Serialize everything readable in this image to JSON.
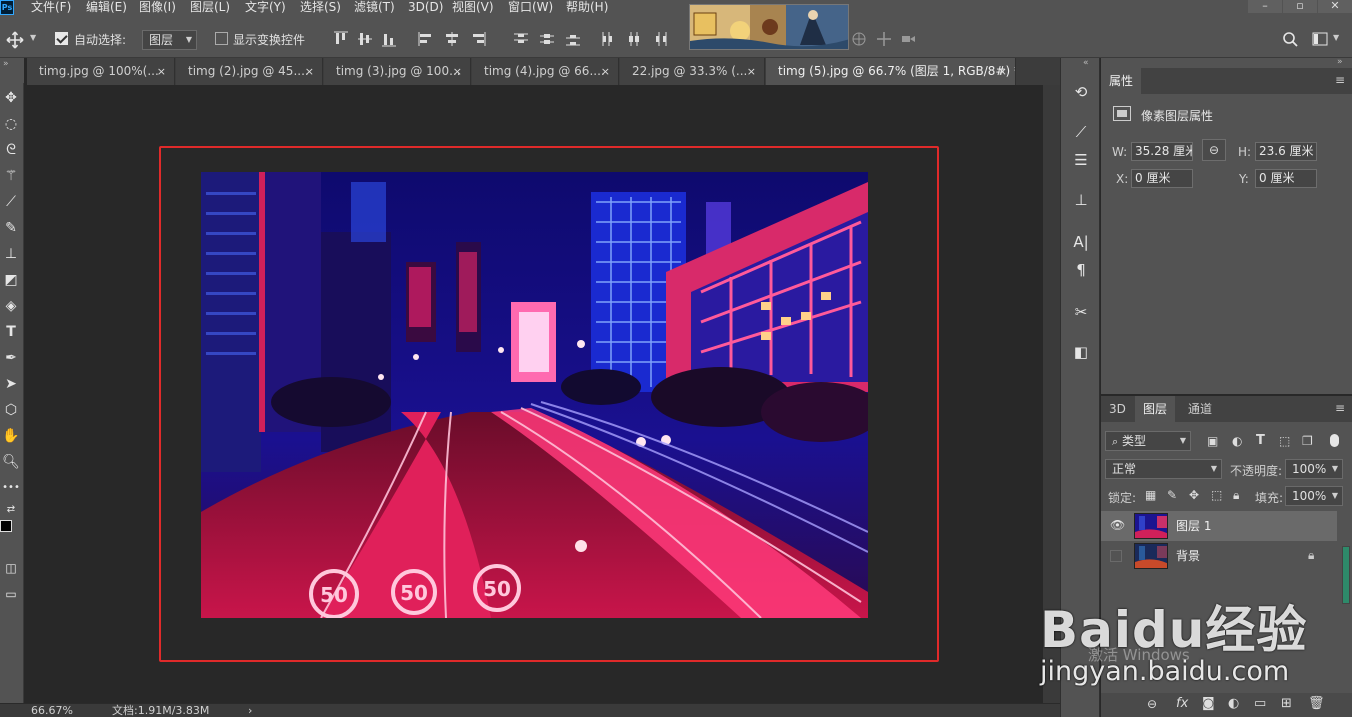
{
  "menu": {
    "items": [
      "文件(F)",
      "编辑(E)",
      "图像(I)",
      "图层(L)",
      "文字(Y)",
      "选择(S)",
      "滤镜(T)",
      "3D(D)",
      "视图(V)",
      "窗口(W)",
      "帮助(H)"
    ],
    "logo": "Ps"
  },
  "options_bar": {
    "auto_select_label": "自动选择:",
    "auto_select_checked": true,
    "auto_select_target": "图层",
    "show_transform_label": "显示变换控件",
    "show_transform_checked": false
  },
  "tabs": [
    {
      "label": "timg.jpg @ 100%(...",
      "active": false
    },
    {
      "label": "timg (2).jpg @ 45....",
      "active": false
    },
    {
      "label": "timg (3).jpg @ 100...",
      "active": false
    },
    {
      "label": "timg (4).jpg @ 66....",
      "active": false
    },
    {
      "label": "22.jpg @ 33.3% (...",
      "active": false
    },
    {
      "label": "timg (5).jpg @ 66.7% (图层 1, RGB/8#) *",
      "active": true
    }
  ],
  "tab_close": "×",
  "status": {
    "zoom": "66.67%",
    "doc": "文档:1.91M/3.83M",
    "arrow": "›"
  },
  "properties": {
    "tab": "属性",
    "title": "像素图层属性",
    "w_label": "W:",
    "w_value": "35.28 厘米",
    "h_label": "H:",
    "h_value": "23.6 厘米",
    "x_label": "X:",
    "x_value": "0 厘米",
    "y_label": "Y:",
    "y_value": "0 厘米"
  },
  "layers_panel": {
    "tabs": [
      "3D",
      "图层",
      "通道"
    ],
    "active_tab": "图层",
    "filter_kind": "类型",
    "blend_mode": "正常",
    "opacity_label": "不透明度:",
    "opacity_value": "100%",
    "lock_label": "锁定:",
    "fill_label": "填充:",
    "fill_value": "100%",
    "layers": [
      {
        "name": "图层 1",
        "visible": true,
        "selected": true,
        "locked": false
      },
      {
        "name": "背景",
        "visible": false,
        "selected": false,
        "locked": true
      }
    ],
    "footer_fx": "fx"
  },
  "watermark": {
    "activate": "激活 Windows",
    "brand": "Baidu经验",
    "site": "jingyan.baidu.com"
  },
  "colors": {
    "app_bg": "#535353",
    "canvas_bg": "#282828",
    "highlight_frame": "#e02a2a"
  }
}
